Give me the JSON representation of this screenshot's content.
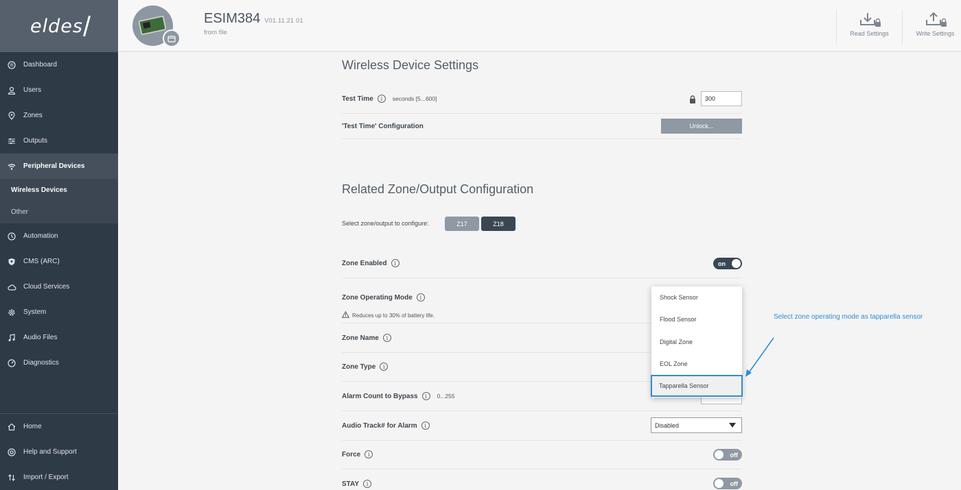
{
  "logo": {
    "text": "eldes"
  },
  "sidebar": {
    "items": [
      {
        "label": "Dashboard",
        "icon": "dashboard-icon"
      },
      {
        "label": "Users",
        "icon": "user-icon"
      },
      {
        "label": "Zones",
        "icon": "location-pin-icon"
      },
      {
        "label": "Outputs",
        "icon": "sliders-icon"
      },
      {
        "label": "Peripheral Devices",
        "icon": "wifi-icon"
      }
    ],
    "sub_items": [
      {
        "label": "Wireless Devices"
      },
      {
        "label": "Other"
      }
    ],
    "items_after": [
      {
        "label": "Automation",
        "icon": "clock-icon"
      },
      {
        "label": "CMS (ARC)",
        "icon": "shield-icon"
      },
      {
        "label": "Cloud Services",
        "icon": "cloud-icon"
      },
      {
        "label": "System",
        "icon": "gear-icon"
      },
      {
        "label": "Audio Files",
        "icon": "music-note-icon"
      },
      {
        "label": "Diagnostics",
        "icon": "gauge-icon"
      }
    ],
    "bottom_items": [
      {
        "label": "Home",
        "icon": "home-icon"
      },
      {
        "label": "Help and Support",
        "icon": "help-icon"
      },
      {
        "label": "Import / Export",
        "icon": "import-export-icon"
      }
    ]
  },
  "header": {
    "device_name": "ESIM384",
    "version": "V01.11.21 01",
    "source": "from file",
    "read_label": "Read Settings",
    "write_label": "Write Settings"
  },
  "wireless": {
    "title": "Wireless Device Settings",
    "test_time_label": "Test Time",
    "test_time_hint": "seconds [5...600]",
    "test_time_value": "300",
    "test_time_config_label": "'Test Time' Configuration",
    "unlock_label": "Unlock..."
  },
  "related": {
    "title": "Related Zone/Output Configuration",
    "select_label": "Select zone/output to configure:",
    "zone_buttons": [
      "Z17",
      "Z18"
    ],
    "zone_enabled_label": "Zone Enabled",
    "zone_enabled_state": "on",
    "operating_mode_label": "Zone Operating Mode",
    "battery_warning": "Reduces up to 30% of battery life.",
    "zone_name_label": "Zone Name",
    "zone_type_label": "Zone Type",
    "alarm_count_label": "Alarm Count to Bypass",
    "alarm_count_hint": "0...255",
    "audio_track_label": "Audio Track# for Alarm",
    "audio_track_value": "Disabled",
    "force_label": "Force",
    "force_state": "off",
    "stay_label": "STAY",
    "stay_state": "off"
  },
  "dropdown": {
    "options": [
      "Shock Sensor",
      "Flood Sensor",
      "Digital Zone",
      "EOL Zone",
      "Tapparella Sensor"
    ],
    "selected": "Tapparella Sensor"
  },
  "annotation": {
    "text": "Select zone operating mode as tapparella sensor",
    "color": "#2f8cd0"
  }
}
